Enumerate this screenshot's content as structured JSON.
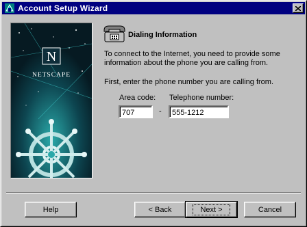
{
  "window": {
    "title": "Account Setup Wizard"
  },
  "banner": {
    "brand_letter": "N",
    "brand_name": "NETSCAPE"
  },
  "page": {
    "heading": "Dialing Information",
    "intro": "To connect to the Internet, you need to provide some information about the phone you are calling from.",
    "instruction": "First, enter the phone number you are calling from.",
    "area_code_label": "Area code:",
    "phone_label": "Telephone number:",
    "area_code_value": "707",
    "separator_dash": "-",
    "phone_value": "555-1212"
  },
  "buttons": {
    "help": "Help",
    "back": "< Back",
    "next": "Next >",
    "cancel": "Cancel"
  },
  "colors": {
    "titlebar": "#000080",
    "face": "#c0c0c0",
    "banner_bg": "#0a2a33",
    "banner_teal": "#1a9a9a"
  }
}
